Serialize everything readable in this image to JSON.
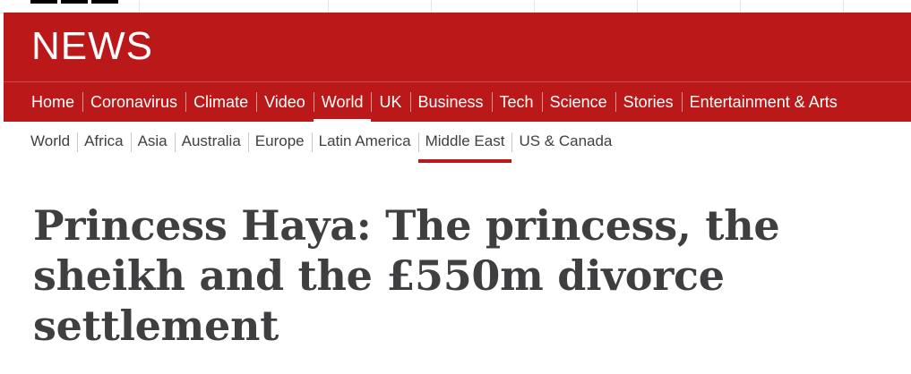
{
  "brand": {
    "name": "NEWS"
  },
  "primary_nav": {
    "items": [
      {
        "label": "Home"
      },
      {
        "label": "Coronavirus"
      },
      {
        "label": "Climate"
      },
      {
        "label": "Video"
      },
      {
        "label": "World"
      },
      {
        "label": "UK"
      },
      {
        "label": "Business"
      },
      {
        "label": "Tech"
      },
      {
        "label": "Science"
      },
      {
        "label": "Stories"
      },
      {
        "label": "Entertainment & Arts"
      }
    ],
    "active": "World"
  },
  "secondary_nav": {
    "items": [
      {
        "label": "World"
      },
      {
        "label": "Africa"
      },
      {
        "label": "Asia"
      },
      {
        "label": "Australia"
      },
      {
        "label": "Europe"
      },
      {
        "label": "Latin America"
      },
      {
        "label": "Middle East"
      },
      {
        "label": "US & Canada"
      }
    ],
    "active": "Middle East"
  },
  "article": {
    "headline_line1": "Princess Haya: The princess, the",
    "headline_line2": "sheikh and the £550m divorce",
    "headline_line3": "settlement"
  },
  "colors": {
    "brand_red": "#bb1919",
    "headline_text": "#3f3f42",
    "secondary_text": "#404040"
  }
}
